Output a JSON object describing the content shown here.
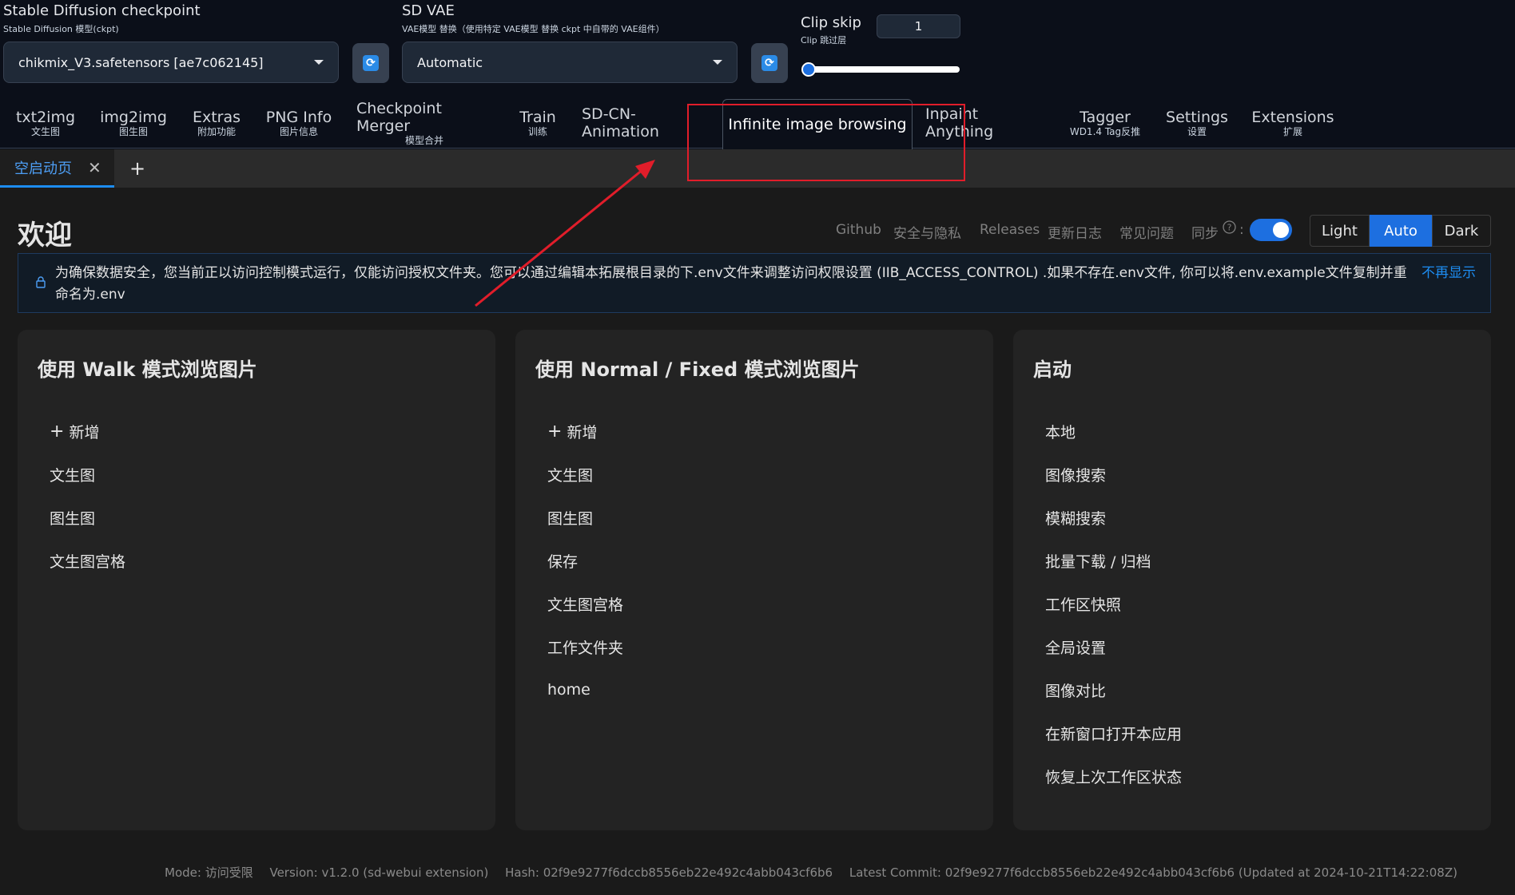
{
  "checkpoint": {
    "title": "Stable Diffusion checkpoint",
    "subtitle": "Stable Diffusion 模型(ckpt)",
    "value": "chikmix_V3.safetensors [ae7c062145]"
  },
  "vae": {
    "title": "SD VAE",
    "subtitle": "VAE模型 替换（使用特定 VAE模型 替换 ckpt 中自带的 VAE组件）",
    "value": "Automatic"
  },
  "clip_skip": {
    "title": "Clip skip",
    "subtitle": "Clip 跳过层",
    "value": "1",
    "slider_fraction": 0.0
  },
  "tabs": [
    {
      "label": "txt2img",
      "sub": "文生图"
    },
    {
      "label": "img2img",
      "sub": "图生图"
    },
    {
      "label": "Extras",
      "sub": "附加功能"
    },
    {
      "label": "PNG Info",
      "sub": "图片信息"
    },
    {
      "label": "Checkpoint Merger",
      "sub": "模型合并"
    },
    {
      "label": "Train",
      "sub": "训练"
    },
    {
      "label": "SD-CN-Animation",
      "sub": ""
    },
    {
      "label": "Infinite image browsing",
      "sub": ""
    },
    {
      "label": "Inpaint Anything",
      "sub": ""
    },
    {
      "label": "Tagger",
      "sub": "WD1.4 Tag反推"
    },
    {
      "label": "Settings",
      "sub": "设置"
    },
    {
      "label": "Extensions",
      "sub": "扩展"
    }
  ],
  "subtab": {
    "label": "空启动页",
    "close": "✕",
    "add": "+"
  },
  "welcome": "欢迎",
  "links": [
    "Github",
    "安全与隐私",
    "Releases",
    "更新日志",
    "常见问题",
    "同步"
  ],
  "sync_suffix": ":",
  "theme": [
    "Light",
    "Auto",
    "Dark"
  ],
  "notice": {
    "message": "为确保数据安全，您当前正以访问控制模式运行，仅能访问授权文件夹。您可以通过编辑本拓展根目录的下.env文件来调整访问权限设置 (IIB_ACCESS_CONTROL) .如果不存在.env文件, 你可以将.env.example文件复制并重命名为.env",
    "dismiss": "不再显示"
  },
  "cards": [
    {
      "title": "使用 Walk 模式浏览图片",
      "items": [
        "新增",
        "文生图",
        "图生图",
        "文生图宫格"
      ]
    },
    {
      "title": "使用 Normal / Fixed 模式浏览图片",
      "items": [
        "新增",
        "文生图",
        "图生图",
        "保存",
        "文生图宫格",
        "工作文件夹",
        "home"
      ]
    },
    {
      "title": "启动",
      "items": [
        "本地",
        "图像搜索",
        "模糊搜索",
        "批量下载 / 归档",
        "工作区快照",
        "全局设置",
        "图像对比",
        "在新窗口打开本应用",
        "恢复上次工作区状态"
      ]
    }
  ],
  "footer": {
    "mode": "Mode: 访问受限",
    "version": "Version: v1.2.0 (sd-webui extension)",
    "hash": "Hash: 02f9e9277f6dccb8556eb22e492c4abb043cf6b6",
    "commit": "Latest Commit: 02f9e9277f6dccb8556eb22e492c4abb043cf6b6 (Updated at 2024-10-21T14:22:08Z)"
  },
  "colors": {
    "accent": "#1d6fe0",
    "link": "#1d8cf0",
    "annotation": "#e11d2a"
  }
}
